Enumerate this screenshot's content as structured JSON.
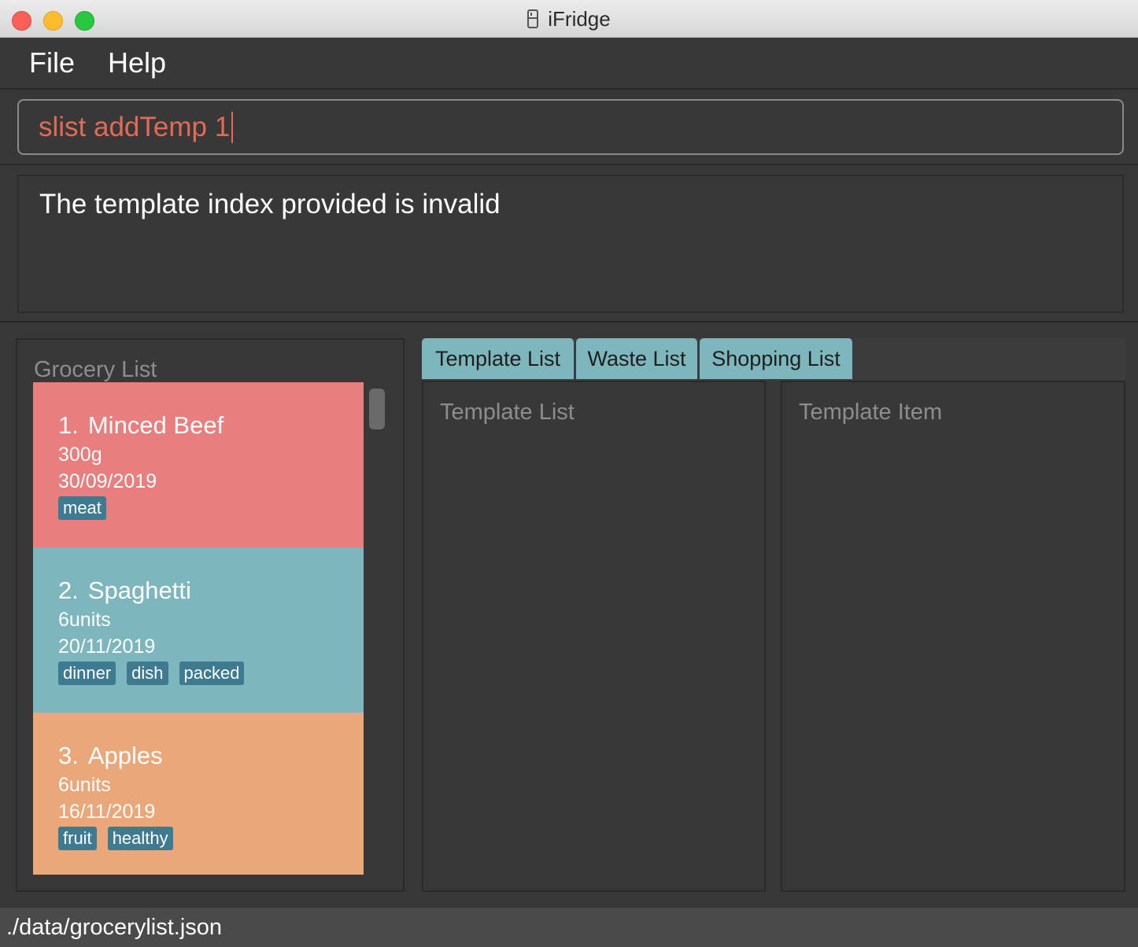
{
  "window": {
    "title": "iFridge",
    "icon": "fridge-icon"
  },
  "menu": {
    "items": [
      {
        "label": "File"
      },
      {
        "label": "Help"
      }
    ]
  },
  "command": {
    "value": "slist addTemp 1"
  },
  "result": {
    "message": "The template index provided is invalid"
  },
  "grocery": {
    "title": "Grocery List",
    "items": [
      {
        "index": "1.",
        "name": "Minced Beef",
        "amount": "300g",
        "expiry": "30/09/2019",
        "tags": [
          "meat"
        ]
      },
      {
        "index": "2.",
        "name": "Spaghetti",
        "amount": "6units",
        "expiry": "20/11/2019",
        "tags": [
          "dinner",
          "dish",
          "packed"
        ]
      },
      {
        "index": "3.",
        "name": "Apples",
        "amount": "6units",
        "expiry": "16/11/2019",
        "tags": [
          "fruit",
          "healthy"
        ]
      }
    ]
  },
  "tabs": [
    {
      "label": "Template List"
    },
    {
      "label": "Waste List"
    },
    {
      "label": "Shopping List"
    }
  ],
  "template_panel": {
    "list_title": "Template List",
    "item_title": "Template Item"
  },
  "status": {
    "path": "./data/grocerylist.json"
  },
  "colors": {
    "card_red": "#e87f7e",
    "card_teal": "#7db6bd",
    "card_orange": "#eaa77a",
    "tag": "#3e7b91",
    "command_text": "#e06c56",
    "background": "#383838"
  }
}
